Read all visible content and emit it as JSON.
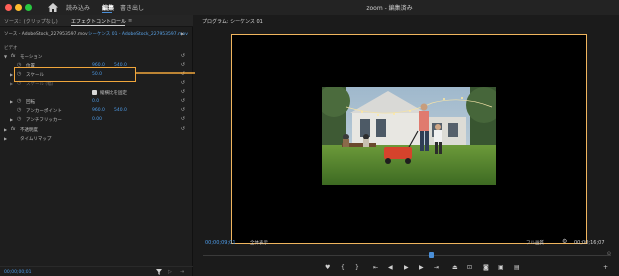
{
  "titlebar": {
    "workspaces": [
      "読み込み",
      "編集",
      "書き出し"
    ],
    "title": "zoom - 編集済み"
  },
  "left_panel": {
    "tabs": {
      "source": "ソース：(クリップなし)",
      "effects": "エフェクトコントロール",
      "menu": "≡"
    },
    "clip": {
      "name": "ソース - AdobeStock_227953597.mov",
      "sequence": "シーケンス 01 - AdobeStock_227953597.mov"
    },
    "section_video": "ビデオ",
    "motion": "モーション",
    "position": {
      "label": "位置",
      "x": "960.0",
      "y": "540.0"
    },
    "scale": {
      "label": "スケール",
      "value": "50.0"
    },
    "scale_width": {
      "label": "スケール (幅)"
    },
    "uniform_scale": "縦横比を固定",
    "rotation": {
      "label": "回転",
      "value": "0.0"
    },
    "anchor": {
      "label": "アンカーポイント",
      "x": "960.0",
      "y": "540.0"
    },
    "antiflicker": {
      "label": "アンチフリッカー",
      "value": "0.00"
    },
    "opacity": "不透明度",
    "time_remap": "タイムリマップ",
    "timecode": "00;00;00;01"
  },
  "right_panel": {
    "tab_title": "プログラム: シーケンス 01",
    "timecode_left": "00;00;09;01",
    "fit": "全体表示",
    "quality": "フル画質",
    "timecode_right": "00;00;16;07"
  },
  "colors": {
    "highlight": "#f0a63c",
    "timecode_blue": "#4d9be8",
    "monitor_frame": "#f0b55e"
  }
}
